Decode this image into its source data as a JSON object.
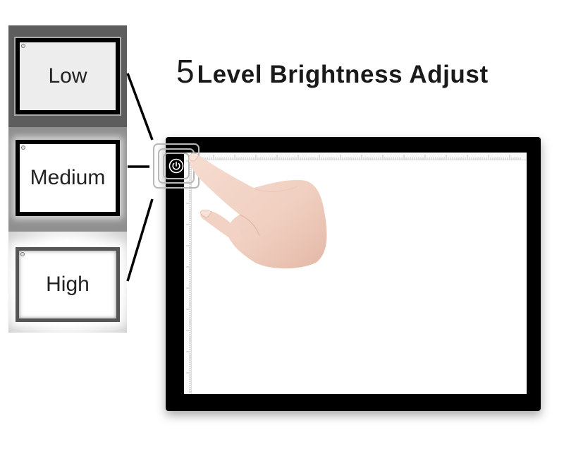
{
  "headline": {
    "number": "5",
    "text": "Level Brightness Adjust"
  },
  "levels": [
    {
      "label": "Low"
    },
    {
      "label": "Medium"
    },
    {
      "label": "High"
    }
  ],
  "tablet": {
    "power_icon": "power-icon",
    "ruler_top": "ruler-scale",
    "ruler_left": "ruler-scale"
  },
  "colors": {
    "frame": "#000000",
    "screen": "#ffffff",
    "low_bg": "#5d5d5d",
    "medium_bg": "#8f8f8f",
    "text": "#1a1a1a"
  }
}
